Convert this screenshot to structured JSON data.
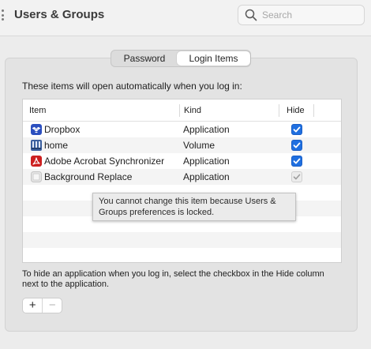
{
  "window": {
    "title": "Users & Groups"
  },
  "search": {
    "placeholder": "Search"
  },
  "tabs": [
    {
      "label": "Password",
      "selected": false
    },
    {
      "label": "Login Items",
      "selected": true
    }
  ],
  "login_items": {
    "intro": "These items will open automatically when you log in:",
    "columns": {
      "item": "Item",
      "kind": "Kind",
      "hide": "Hide"
    },
    "rows": [
      {
        "name": "Dropbox",
        "kind": "Application",
        "hide": true,
        "icon": "dropbox-icon",
        "icon_color": "#2b4fbf",
        "enabled": true
      },
      {
        "name": "home",
        "kind": "Volume",
        "hide": true,
        "icon": "network-volume-icon",
        "icon_color": "#3b5f9e",
        "enabled": true
      },
      {
        "name": "Adobe Acrobat Synchronizer",
        "kind": "Application",
        "hide": true,
        "icon": "acrobat-icon",
        "icon_color": "#cc1f1f",
        "enabled": true
      },
      {
        "name": "Background Replace",
        "kind": "Application",
        "hide": true,
        "icon": "generic-app-icon",
        "icon_color": "#d9d9d9",
        "enabled": false
      }
    ],
    "tooltip": "You cannot change this item because Users & Groups preferences is locked.",
    "help": "To hide an application when you log in, select the checkbox in the Hide column next to the application.",
    "add_label": "+",
    "remove_label": "−"
  },
  "colors": {
    "accent": "#1f6fe0",
    "window_bg": "#ececec"
  }
}
